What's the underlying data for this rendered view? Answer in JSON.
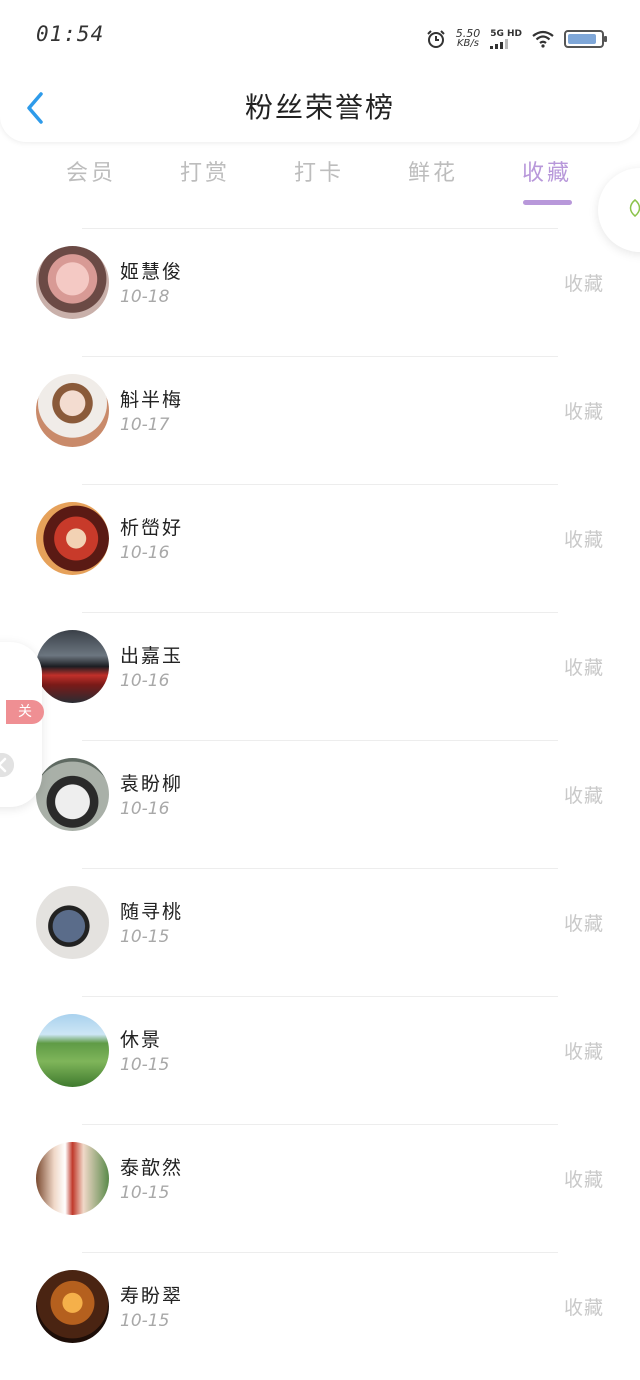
{
  "status_bar": {
    "time": "01:54",
    "speed_value": "5.50",
    "speed_unit": "KB/s",
    "network": "5G HD",
    "icons": [
      "alarm-icon",
      "signal-icon",
      "wifi-icon",
      "battery-icon"
    ]
  },
  "header": {
    "back_icon": "chevron-left-icon",
    "title": "粉丝荣誉榜"
  },
  "tabs": [
    {
      "label": "会员",
      "active": false
    },
    {
      "label": "打赏",
      "active": false
    },
    {
      "label": "打卡",
      "active": false
    },
    {
      "label": "鲜花",
      "active": false
    },
    {
      "label": "收藏",
      "active": true
    }
  ],
  "colors": {
    "accent": "#b898da",
    "tab_inactive": "#bdbdbd",
    "back_icon": "#2e9bea",
    "badge": "#ef8f93"
  },
  "fans": [
    {
      "name": "姬慧俊",
      "date": "10-18",
      "action": "收藏"
    },
    {
      "name": "斛半梅",
      "date": "10-17",
      "action": "收藏"
    },
    {
      "name": "析嵤好",
      "date": "10-16",
      "action": "收藏"
    },
    {
      "name": "出嘉玉",
      "date": "10-16",
      "action": "收藏"
    },
    {
      "name": "袁盼柳",
      "date": "10-16",
      "action": "收藏"
    },
    {
      "name": "随寻桃",
      "date": "10-15",
      "action": "收藏"
    },
    {
      "name": "休景",
      "date": "10-15",
      "action": "收藏"
    },
    {
      "name": "泰歆然",
      "date": "10-15",
      "action": "收藏"
    },
    {
      "name": "寿盼翠",
      "date": "10-15",
      "action": "收藏"
    }
  ],
  "floating": {
    "close_badge": "关"
  }
}
